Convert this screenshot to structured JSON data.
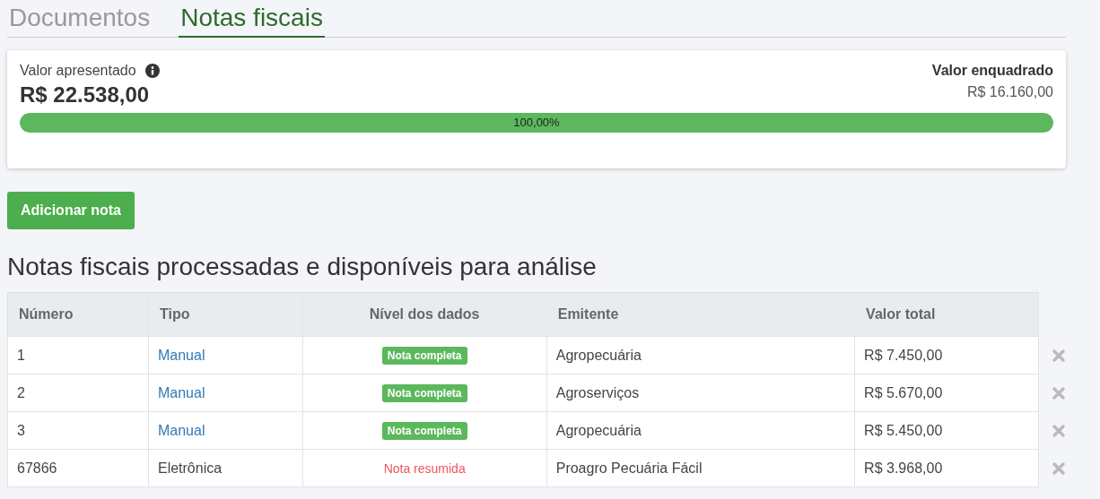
{
  "tabs": [
    {
      "label": "Documentos",
      "selected": false
    },
    {
      "label": "Notas fiscais",
      "selected": true
    }
  ],
  "summary": {
    "label": "Valor apresentado",
    "value": "R$ 22.538,00",
    "right_label": "Valor enquadrado",
    "right_value": "R$ 16.160,00",
    "progress": {
      "level": 1.0,
      "reading": "100,00%"
    }
  },
  "add_button": "Adicionar nota",
  "section_title": "Notas fiscais processadas e disponíveis para análise",
  "table": {
    "columns": [
      "Número",
      "Tipo",
      "Nível dos dados",
      "Emitente",
      "Valor total"
    ],
    "rows": [
      {
        "numero": "1",
        "tipo": {
          "text": "Manual",
          "link": true
        },
        "nivel": {
          "text": "Nota completa",
          "kind": "badge"
        },
        "emitente": "Agropecuária",
        "valor": "R$ 7.450,00"
      },
      {
        "numero": "2",
        "tipo": {
          "text": "Manual",
          "link": true
        },
        "nivel": {
          "text": "Nota completa",
          "kind": "badge"
        },
        "emitente": "Agroserviços",
        "valor": "R$ 5.670,00"
      },
      {
        "numero": "3",
        "tipo": {
          "text": "Manual",
          "link": true
        },
        "nivel": {
          "text": "Nota completa",
          "kind": "badge"
        },
        "emitente": "Agropecuária",
        "valor": "R$ 5.450,00"
      },
      {
        "numero": "67866",
        "tipo": {
          "text": "Eletrônica",
          "link": false
        },
        "nivel": {
          "text": "Nota resumida",
          "kind": "warning"
        },
        "emitente": "Proagro Pecuária Fácil",
        "valor": "R$ 3.968,00"
      }
    ]
  }
}
